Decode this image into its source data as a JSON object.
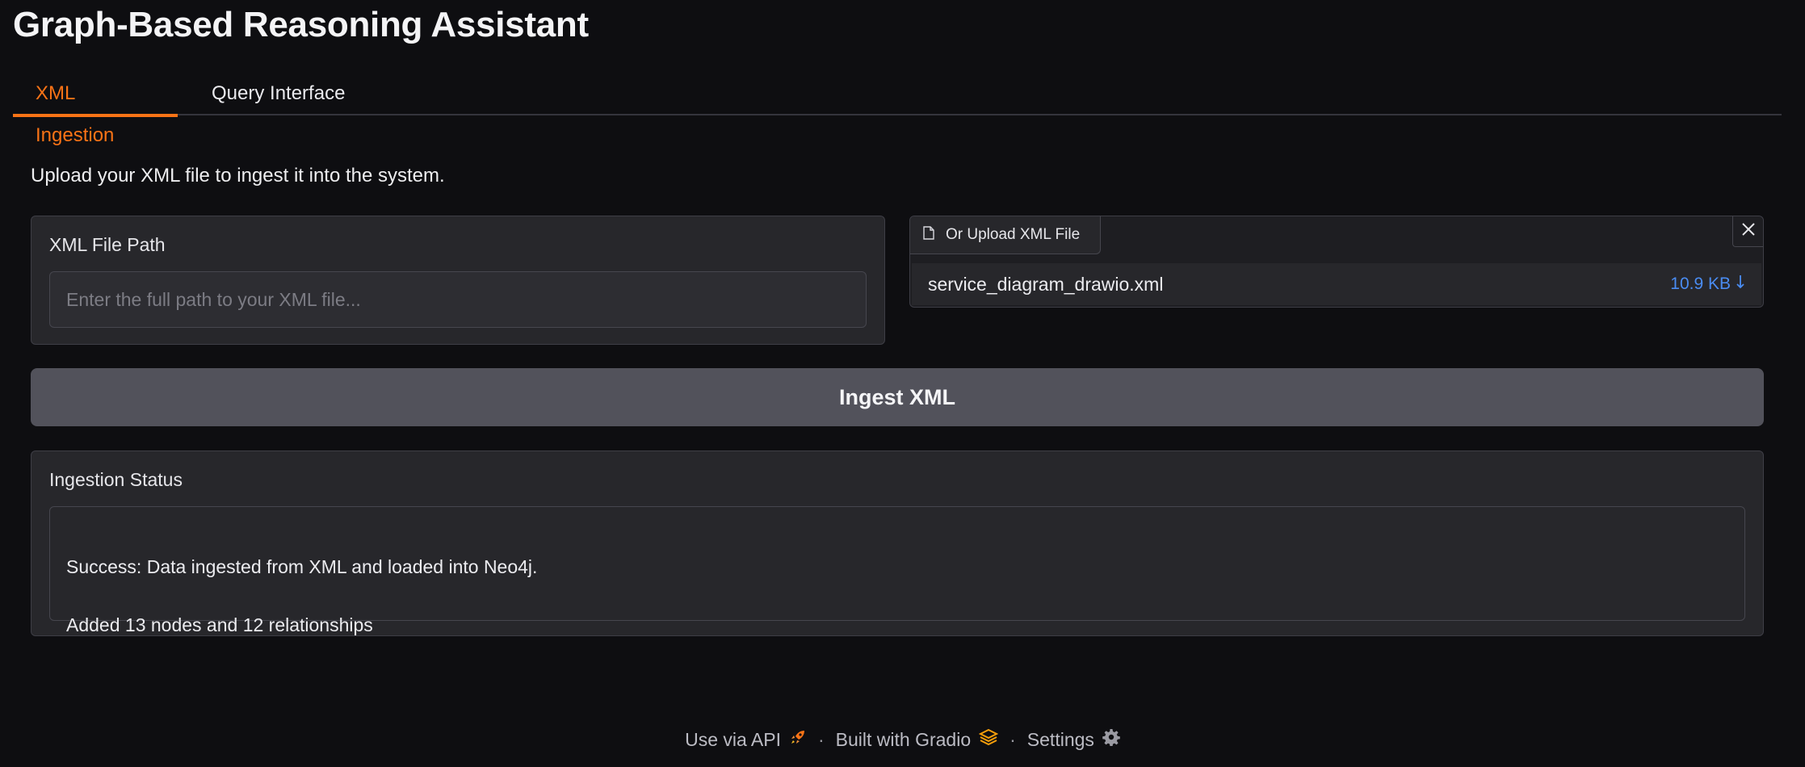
{
  "app": {
    "title": "Graph-Based Reasoning Assistant"
  },
  "tabs": [
    {
      "label": "XML Ingestion",
      "active": true
    },
    {
      "label": "Query Interface",
      "active": false
    }
  ],
  "ingestion": {
    "intro": "Upload your XML file to ingest it into the system.",
    "path_field": {
      "label": "XML File Path",
      "placeholder": "Enter the full path to your XML file...",
      "value": ""
    },
    "upload": {
      "label": "Or Upload XML File",
      "file_name": "service_diagram_drawio.xml",
      "file_size": "10.9 KB"
    },
    "ingest_button": "Ingest XML",
    "status": {
      "label": "Ingestion Status",
      "lines": [
        "Success: Data ingested from XML and loaded into Neo4j.",
        "Added 13 nodes and 12 relationships"
      ]
    }
  },
  "footer": {
    "api": "Use via API",
    "built": "Built with Gradio",
    "settings": "Settings",
    "separator": "·"
  },
  "colors": {
    "accent": "#f97316",
    "link": "#4a8cf2",
    "gradio": "#f59e0b"
  }
}
